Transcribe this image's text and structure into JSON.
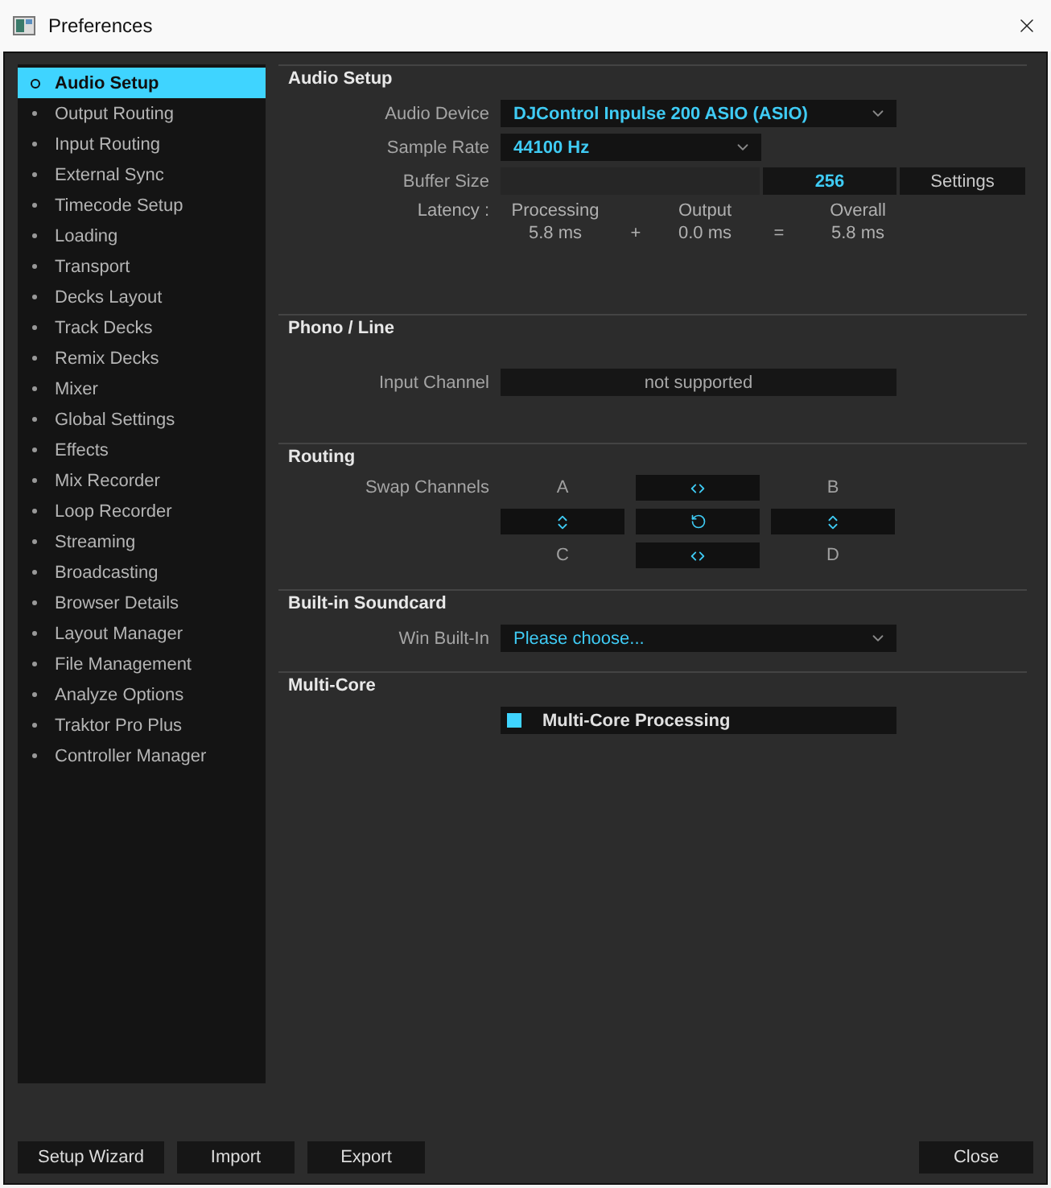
{
  "window": {
    "title": "Preferences"
  },
  "sidebar": {
    "items": [
      {
        "label": "Audio Setup",
        "selected": true
      },
      {
        "label": "Output Routing",
        "selected": false
      },
      {
        "label": "Input Routing",
        "selected": false
      },
      {
        "label": "External Sync",
        "selected": false
      },
      {
        "label": "Timecode Setup",
        "selected": false
      },
      {
        "label": "Loading",
        "selected": false
      },
      {
        "label": "Transport",
        "selected": false
      },
      {
        "label": "Decks Layout",
        "selected": false
      },
      {
        "label": "Track Decks",
        "selected": false
      },
      {
        "label": "Remix Decks",
        "selected": false
      },
      {
        "label": "Mixer",
        "selected": false
      },
      {
        "label": "Global Settings",
        "selected": false
      },
      {
        "label": "Effects",
        "selected": false
      },
      {
        "label": "Mix Recorder",
        "selected": false
      },
      {
        "label": "Loop Recorder",
        "selected": false
      },
      {
        "label": "Streaming",
        "selected": false
      },
      {
        "label": "Broadcasting",
        "selected": false
      },
      {
        "label": "Browser Details",
        "selected": false
      },
      {
        "label": "Layout Manager",
        "selected": false
      },
      {
        "label": "File Management",
        "selected": false
      },
      {
        "label": "Analyze Options",
        "selected": false
      },
      {
        "label": "Traktor Pro Plus",
        "selected": false
      },
      {
        "label": "Controller Manager",
        "selected": false
      }
    ]
  },
  "audio_setup": {
    "title": "Audio Setup",
    "audio_device": {
      "label": "Audio Device",
      "value": "DJControl Inpulse 200 ASIO (ASIO)"
    },
    "sample_rate": {
      "label": "Sample Rate",
      "value": "44100 Hz"
    },
    "buffer_size": {
      "label": "Buffer Size",
      "level": 0,
      "value": "256",
      "button": "Settings"
    },
    "latency": {
      "label": "Latency :",
      "processing": {
        "label": "Processing",
        "value": "5.8 ms"
      },
      "plus": "+",
      "output": {
        "label": "Output",
        "value": "0.0 ms"
      },
      "equals": "=",
      "overall": {
        "label": "Overall",
        "value": "5.8 ms"
      }
    }
  },
  "phono_line": {
    "title": "Phono / Line",
    "input_channel": {
      "label": "Input Channel",
      "value": "not supported"
    }
  },
  "routing": {
    "title": "Routing",
    "swap_label": "Swap Channels",
    "channels": [
      "A",
      "B",
      "C",
      "D"
    ]
  },
  "builtin_soundcard": {
    "title": "Built-in Soundcard",
    "win_builtin": {
      "label": "Win Built-In",
      "value": "Please choose..."
    }
  },
  "multi_core": {
    "title": "Multi-Core",
    "processing": {
      "label": "Multi-Core Processing",
      "checked": true
    }
  },
  "footer": {
    "left_buttons": [
      "Setup Wizard",
      "Import",
      "Export"
    ],
    "close": "Close"
  }
}
